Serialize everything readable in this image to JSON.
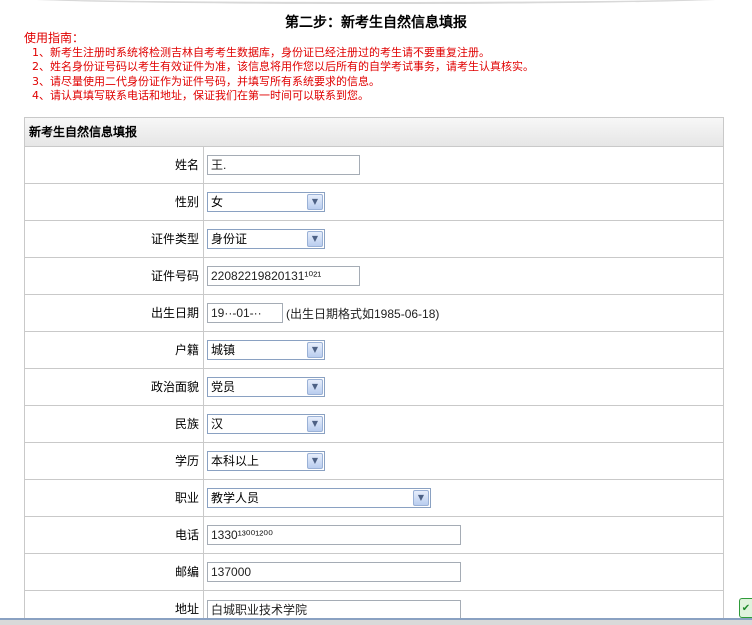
{
  "page": {
    "title": "第二步：新考生自然信息填报"
  },
  "guide": {
    "title": "使用指南：",
    "items": [
      "1、新考生注册时系统将检测吉林自考考生数据库，身份证已经注册过的考生请不要重复注册。",
      "2、姓名身份证号码以考生有效证件为准，该信息将用作您以后所有的自学考试事务，请考生认真核实。",
      "3、请尽量使用二代身份证作为证件号码，并填写所有系统要求的信息。",
      "4、请认真填写联系电话和地址，保证我们在第一时间可以联系到您。"
    ]
  },
  "form": {
    "header": "新考生自然信息填报",
    "fields": {
      "name": {
        "label": "姓名",
        "value": "王."
      },
      "gender": {
        "label": "性别",
        "value": "女"
      },
      "id_type": {
        "label": "证件类型",
        "value": "身份证"
      },
      "id_number": {
        "label": "证件号码",
        "value": "22082219820131¹⁰²¹"
      },
      "birth_date": {
        "label": "出生日期",
        "value": "19··-01-··",
        "hint": "(出生日期格式如1985-06-18)"
      },
      "household": {
        "label": "户籍",
        "value": "城镇"
      },
      "political": {
        "label": "政治面貌",
        "value": "党员"
      },
      "ethnicity": {
        "label": "民族",
        "value": "汉"
      },
      "education": {
        "label": "学历",
        "value": "本科以上"
      },
      "occupation": {
        "label": "职业",
        "value": "教学人员"
      },
      "phone": {
        "label": "电话",
        "value": "1330¹³⁰⁰¹²⁰⁰"
      },
      "postcode": {
        "label": "邮编",
        "value": "137000"
      },
      "address": {
        "label": "地址",
        "value": "白城职业技术学院"
      }
    }
  },
  "icons": {
    "dropdown": "chevron-down-icon"
  },
  "colors": {
    "guide_text": "#e00000",
    "border": "#c9c9c9",
    "select_border": "#8aa1c2"
  }
}
